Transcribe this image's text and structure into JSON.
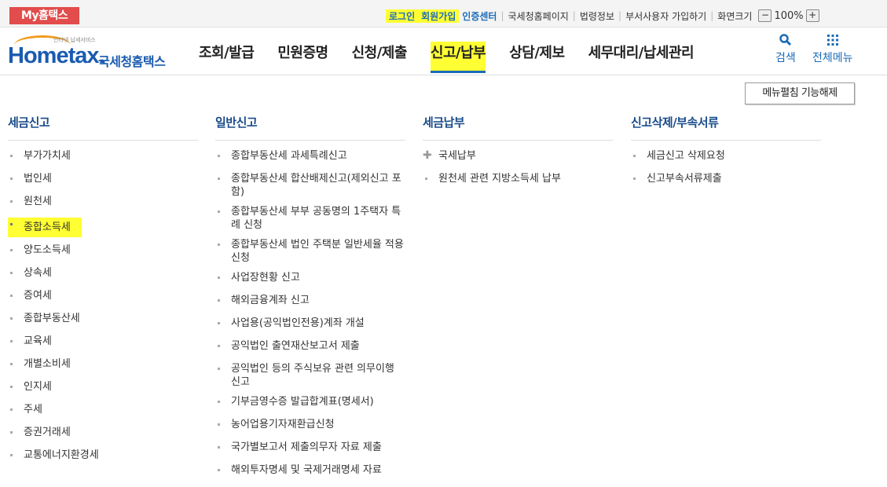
{
  "topbar": {
    "my_hometax": "My홈택스",
    "links": [
      {
        "label": "로그인",
        "bold": true,
        "highlight": true
      },
      {
        "label": "회원가입",
        "bold": true,
        "highlight": true
      },
      {
        "label": "인증센터",
        "bold": true,
        "highlight": false
      },
      {
        "label": "국세청홈페이지",
        "bold": false,
        "highlight": false
      },
      {
        "label": "법령정보",
        "bold": false,
        "highlight": false
      },
      {
        "label": "부서사용자 가입하기",
        "bold": false,
        "highlight": false
      },
      {
        "label": "화면크기",
        "bold": false,
        "highlight": false
      }
    ],
    "zoom_minus": "−",
    "zoom_value": "100%",
    "zoom_plus": "+"
  },
  "header": {
    "logo_tiny": "인터넷 납세서비스",
    "logo_brand": "Hometax.",
    "logo_kr": "국세청홈택스",
    "nav": [
      "조회/발급",
      "민원증명",
      "신청/제출",
      "신고/납부",
      "상담/제보",
      "세무대리/납세관리"
    ],
    "active_nav": "신고/납부",
    "search_label": "검색",
    "allmenu_label": "전체메뉴"
  },
  "content": {
    "collapse_button": "메뉴펼침 기능해제",
    "columns": [
      {
        "title": "세금신고",
        "items": [
          "부가가치세",
          "법인세",
          "원천세",
          "종합소득세",
          "양도소득세",
          "상속세",
          "증여세",
          "종합부동산세",
          "교육세",
          "개별소비세",
          "인지세",
          "주세",
          "증권거래세",
          "교통에너지환경세"
        ],
        "highlighted": "종합소득세"
      },
      {
        "title": "일반신고",
        "items": [
          "종합부동산세 과세특례신고",
          "종합부동산세 합산배제신고(제외신고 포함)",
          "종합부동산세 부부 공동명의 1주택자 특례 신청",
          "종합부동산세 법인 주택분 일반세율 적용 신청",
          "사업장현황 신고",
          "해외금융계좌 신고",
          "사업용(공익법인전용)계좌 개설",
          "공익법인 출연재산보고서 제출",
          "공익법인 등의 주식보유 관련 의무이행 신고",
          "기부금영수증 발급합계표(명세서)",
          "농어업용기자재환급신청",
          "국가별보고서 제출의무자 자료 제출",
          "해외투자명세 및 국제거래명세 자료"
        ]
      },
      {
        "title": "세금납부",
        "items": [
          "국세납부",
          "원천세 관련 지방소득세 납부"
        ],
        "plus_first": true
      },
      {
        "title": "신고삭제/부속서류",
        "items": [
          "세금신고 삭제요청",
          "신고부속서류제출"
        ]
      }
    ]
  },
  "colors": {
    "accent": "#1b6bb8",
    "highlight": "#ffff33",
    "my_hometax_bg": "#e24c4c",
    "logo_orange": "#f29b1d"
  },
  "icons": [
    "search-icon",
    "grid-menu-icon",
    "zoom-minus-icon",
    "zoom-plus-icon",
    "plus-icon"
  ]
}
